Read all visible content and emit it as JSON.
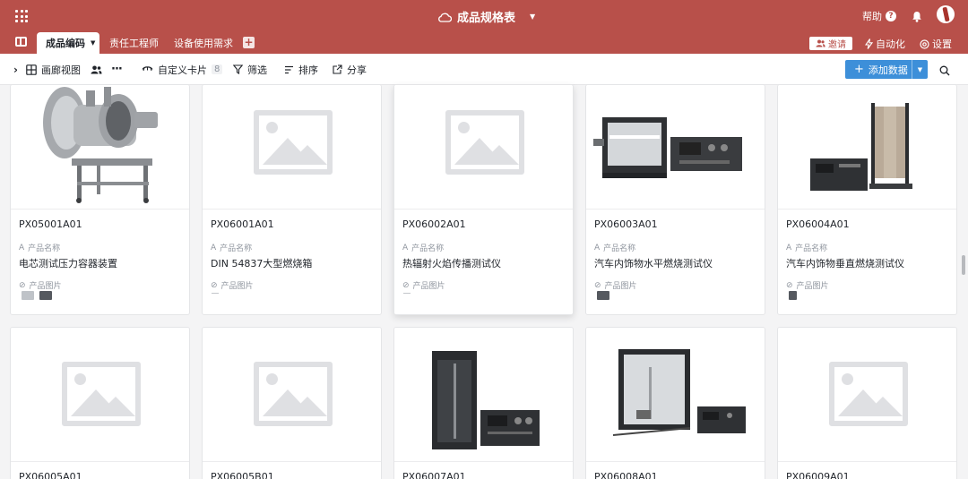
{
  "header": {
    "doc_title": "成品规格表",
    "help_label": "帮助"
  },
  "table_tabs": [
    {
      "label": "成品编码"
    },
    {
      "label": "责任工程师"
    },
    {
      "label": "设备使用需求"
    }
  ],
  "header_actions": {
    "invite_label": "邀请",
    "automation_label": "自动化",
    "settings_label": "设置"
  },
  "toolbar": {
    "view_label": "画廊视图",
    "customize_label": "自定义卡片",
    "customize_count": "8",
    "filter_label": "筛选",
    "sort_label": "排序",
    "share_label": "分享",
    "add_label": "添加数据"
  },
  "field_labels": {
    "name": "产品名称",
    "image": "产品图片"
  },
  "cards": [
    {
      "code": "PX05001A01",
      "name": "电芯测试压力容器装置"
    },
    {
      "code": "PX06001A01",
      "name": "DIN 54837大型燃烧箱"
    },
    {
      "code": "PX06002A01",
      "name": "热辐射火焰传播测试仪"
    },
    {
      "code": "PX06003A01",
      "name": "汽车内饰物水平燃烧测试仪"
    },
    {
      "code": "PX06004A01",
      "name": "汽车内饰物垂直燃烧测试仪"
    },
    {
      "code": "PX06005A01"
    },
    {
      "code": "PX06005B01"
    },
    {
      "code": "PX06007A01"
    },
    {
      "code": "PX06008A01"
    },
    {
      "code": "PX06009A01"
    }
  ],
  "colors": {
    "brand": "#b8504a",
    "primary_button": "#3d8fd9"
  }
}
